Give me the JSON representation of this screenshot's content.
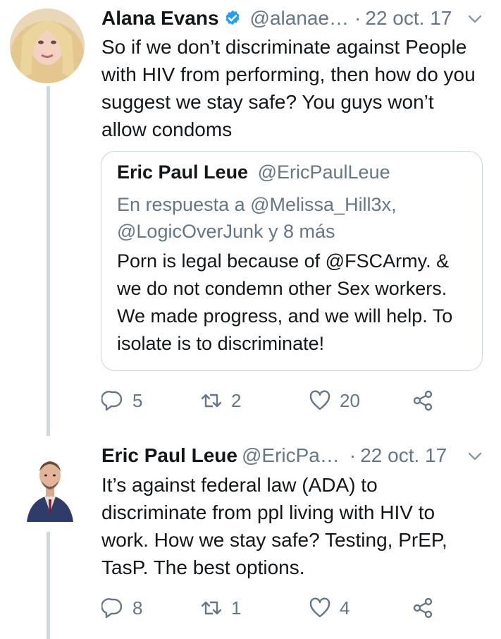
{
  "tweets": [
    {
      "author_name": "Alana Evans",
      "verified": true,
      "handle": "@alanae…",
      "separator": "·",
      "date": "22 oct. 17",
      "text": "So if we don’t discriminate against People with HIV from performing, then how do you suggest we stay safe? You guys won’t allow condoms",
      "quoted": {
        "author_name": "Eric Paul Leue",
        "handle": "@EricPaulLeue",
        "reply_to": "En respuesta a @Melissa_Hill3x, @LogicOverJunk y 8 más",
        "text": "Porn is legal because of @FSCArmy. & we do not condemn other Sex workers. We made progress, and we will help. To isolate is to discriminate!"
      },
      "actions": {
        "replies": "5",
        "retweets": "2",
        "likes": "20"
      }
    },
    {
      "author_name": "Eric Paul Leue",
      "verified": false,
      "handle": "@EricPa…",
      "separator": "·",
      "date": "22 oct. 17",
      "text": "It’s against federal law (ADA) to discriminate from ppl living with HIV to work. How we stay safe? Testing, PrEP, TasP. The best options.",
      "actions": {
        "replies": "8",
        "retweets": "1",
        "likes": "4"
      }
    }
  ],
  "colors": {
    "accent": "#1da1f2",
    "secondary_text": "#657786",
    "thread_line": "#cfd9de"
  },
  "icons": [
    "verified-badge-icon",
    "chevron-down-icon",
    "reply-icon",
    "retweet-icon",
    "like-icon",
    "share-icon"
  ]
}
